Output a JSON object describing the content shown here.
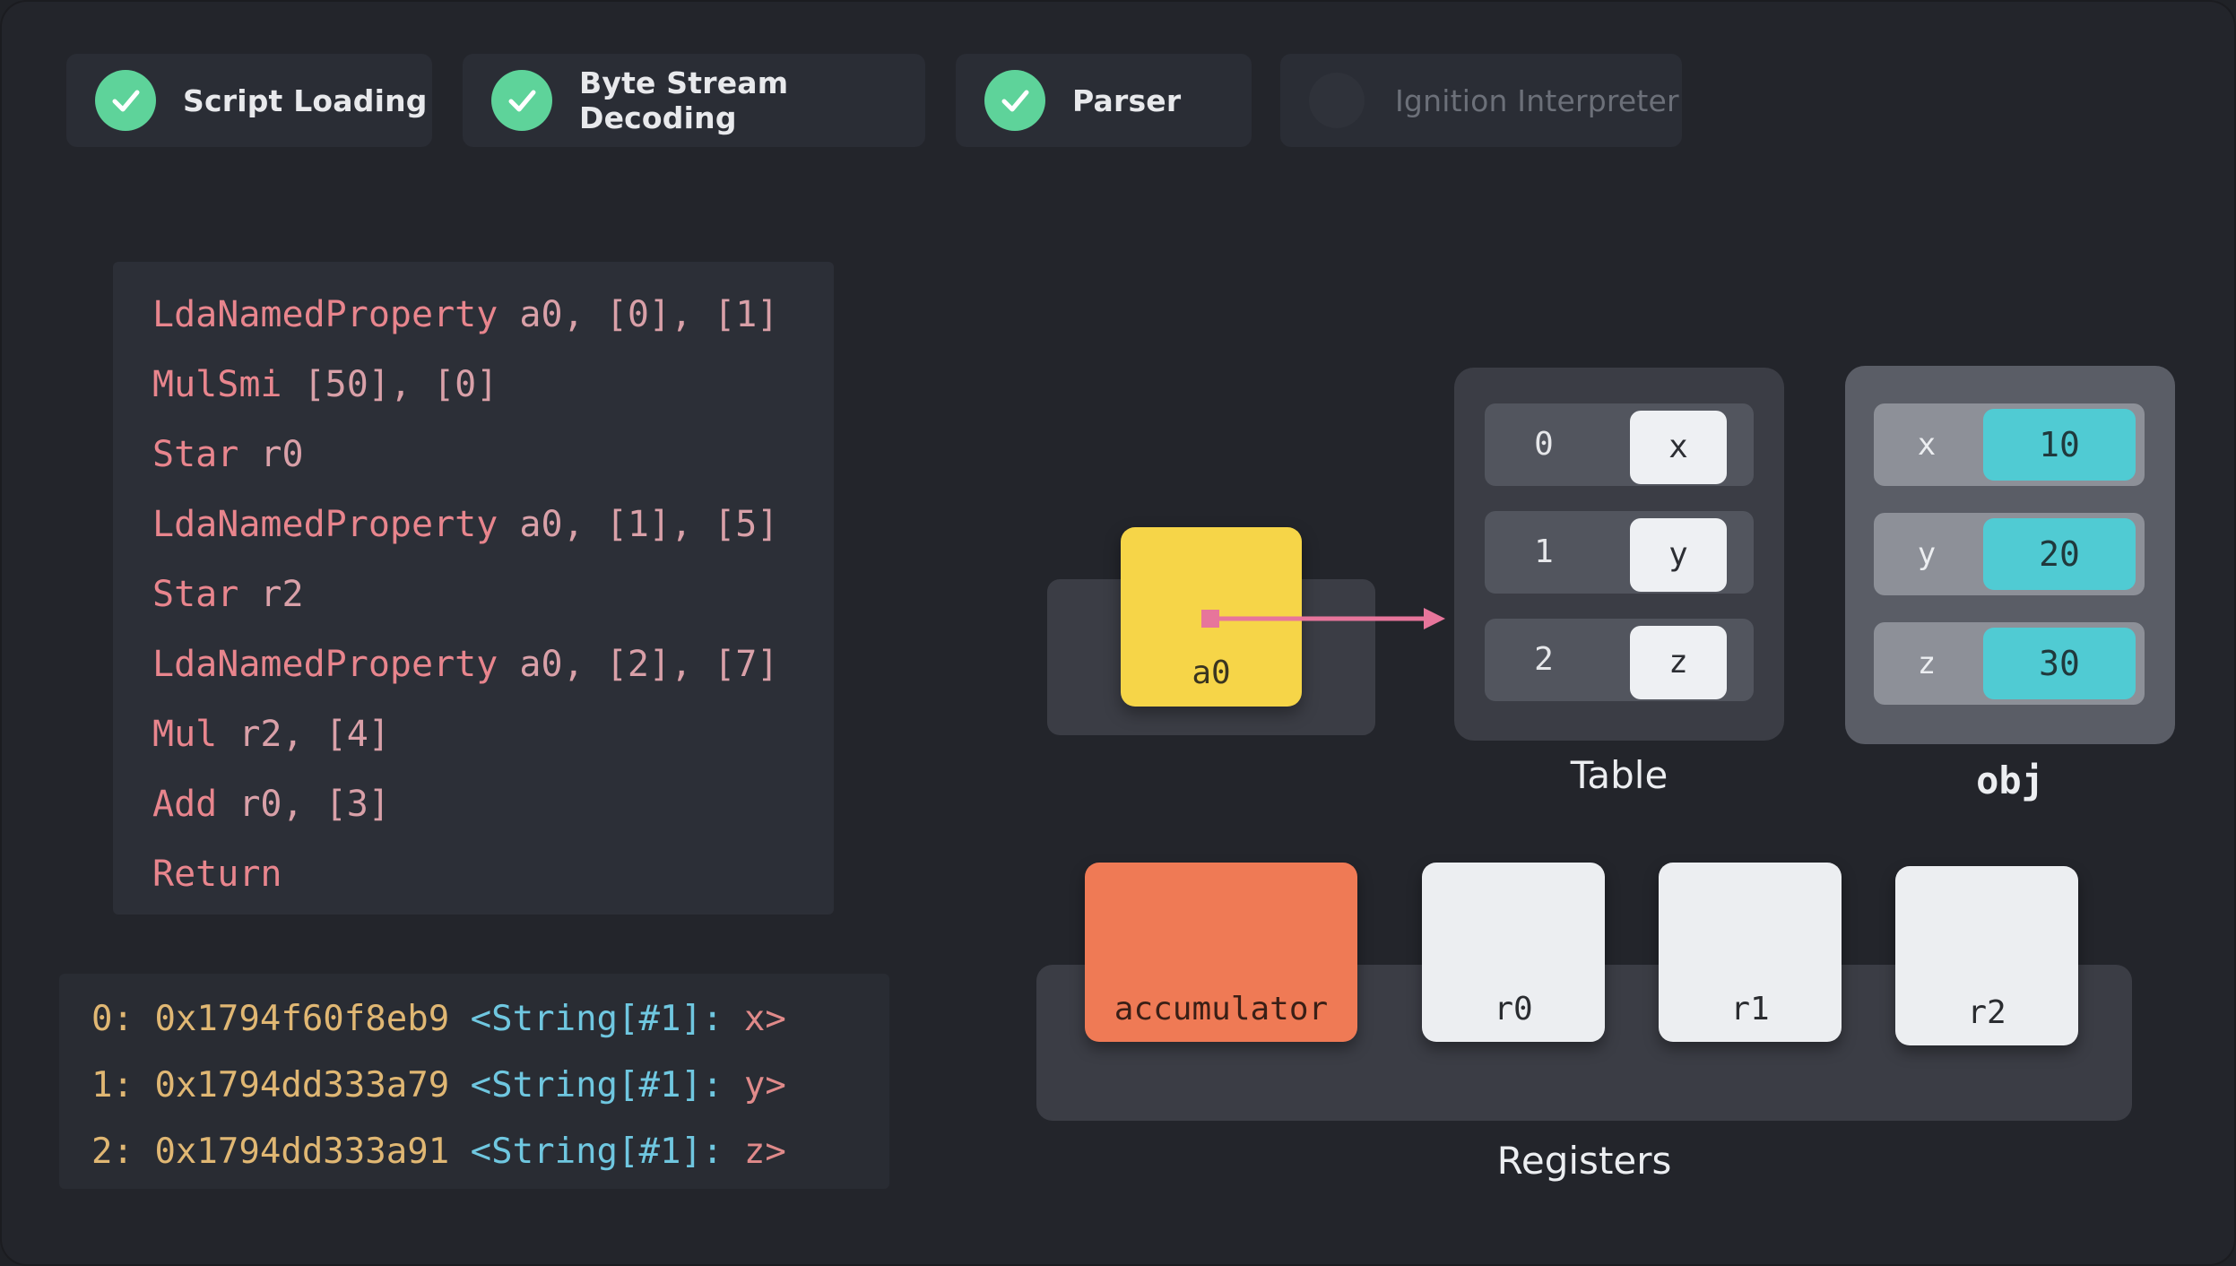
{
  "stages": [
    {
      "label": "Script Loading",
      "status": "done"
    },
    {
      "label": "Byte Stream Decoding",
      "status": "done"
    },
    {
      "label": "Parser",
      "status": "done"
    },
    {
      "label": "Ignition Interpreter",
      "status": "pending"
    }
  ],
  "bytecode": [
    {
      "op": "LdaNamedProperty",
      "args": "a0, [0], [1]"
    },
    {
      "op": "MulSmi",
      "args": "[50], [0]"
    },
    {
      "op": "Star",
      "args": "r0"
    },
    {
      "op": "LdaNamedProperty",
      "args": "a0, [1], [5]"
    },
    {
      "op": "Star",
      "args": "r2"
    },
    {
      "op": "LdaNamedProperty",
      "args": "a0, [2], [7]"
    },
    {
      "op": "Mul",
      "args": "r2, [4]"
    },
    {
      "op": "Add",
      "args": "r0, [3]"
    },
    {
      "op": "Return",
      "args": ""
    }
  ],
  "constant_pool": [
    {
      "index": "0:",
      "address": "0x1794f60f8eb9",
      "type": "<String[#1]:",
      "value": "x>"
    },
    {
      "index": "1:",
      "address": "0x1794dd333a79",
      "type": "<String[#1]:",
      "value": "y>"
    },
    {
      "index": "2:",
      "address": "0x1794dd333a91",
      "type": "<String[#1]:",
      "value": "z>"
    }
  ],
  "a0": {
    "label": "a0"
  },
  "table": {
    "caption": "Table",
    "rows": [
      {
        "index": "0",
        "key": "x"
      },
      {
        "index": "1",
        "key": "y"
      },
      {
        "index": "2",
        "key": "z"
      }
    ]
  },
  "obj": {
    "caption": "obj",
    "rows": [
      {
        "key": "x",
        "value": "10"
      },
      {
        "key": "y",
        "value": "20"
      },
      {
        "key": "z",
        "value": "30"
      }
    ]
  },
  "registers": {
    "caption": "Registers",
    "items": [
      {
        "label": "accumulator"
      },
      {
        "label": "r0"
      },
      {
        "label": "r1"
      },
      {
        "label": "r2"
      }
    ]
  },
  "colors": {
    "check": "#5ed39a",
    "a0": "#f6d548",
    "accumulator": "#ef7a55",
    "obj_value": "#50cbd3",
    "arrow": "#e7759b"
  }
}
